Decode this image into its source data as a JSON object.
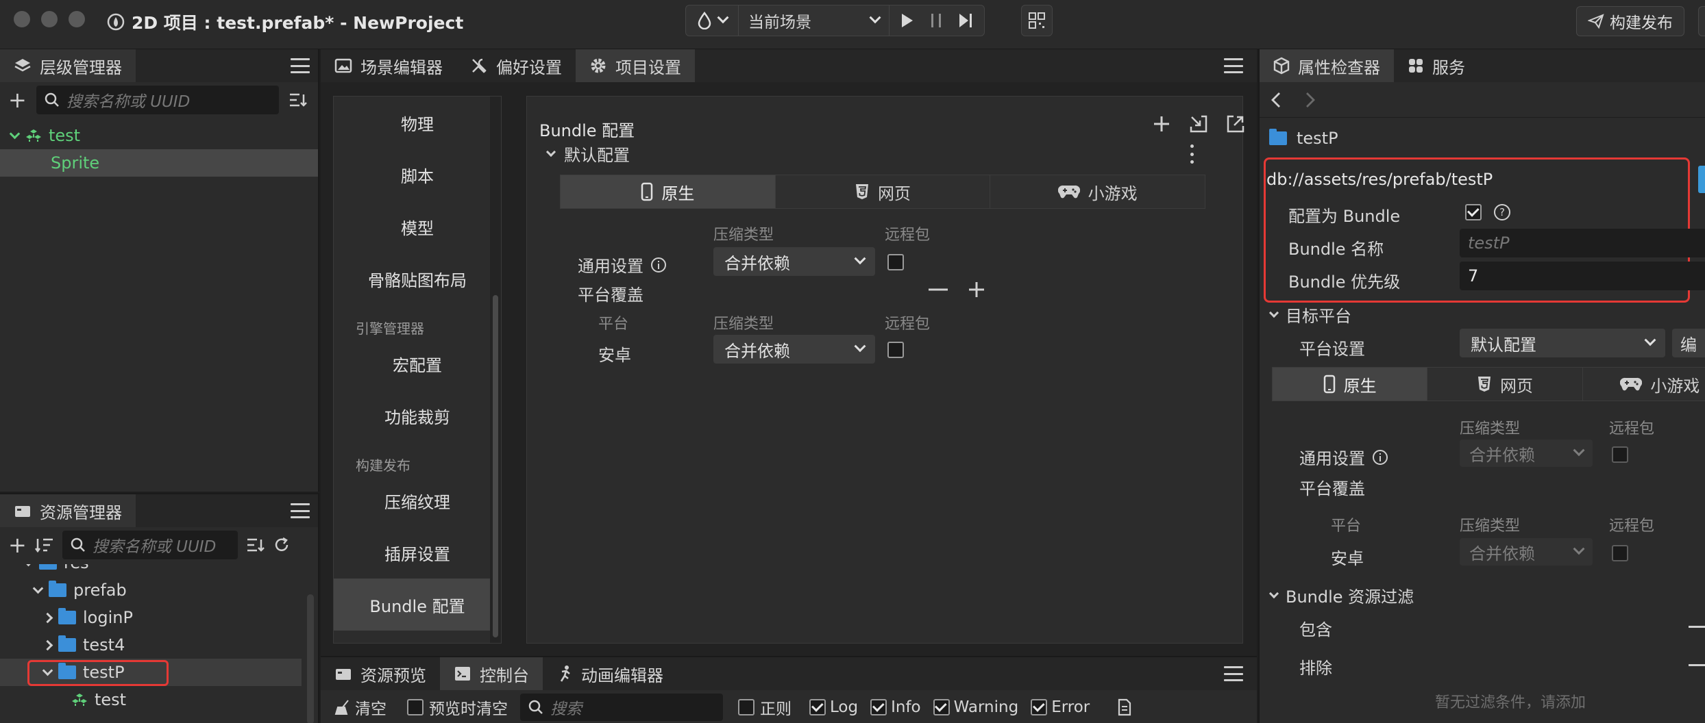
{
  "window": {
    "title": "2D 项目 : test.prefab* - NewProject",
    "scene_select": "当前场景",
    "build_button": "构建发布"
  },
  "hierarchy": {
    "tab": "层级管理器",
    "search_placeholder": "搜索名称或 UUID",
    "root": "test",
    "child": "Sprite"
  },
  "assets": {
    "tab": "资源管理器",
    "search_placeholder": "搜索名称或 UUID",
    "items": {
      "res": "res",
      "prefab": "prefab",
      "loginP": "loginP",
      "test4": "test4",
      "testP": "testP",
      "test": "test"
    }
  },
  "center_tabs": {
    "scene_editor": "场景编辑器",
    "preferences": "偏好设置",
    "project_settings": "项目设置"
  },
  "settings_nav": {
    "items": [
      "物理",
      "脚本",
      "模型",
      "骨骼贴图布局"
    ],
    "group_engine": "引擎管理器",
    "engine_items": [
      "宏配置",
      "功能裁剪"
    ],
    "group_build": "构建发布",
    "build_items": [
      "压缩纹理",
      "插屏设置",
      "Bundle 配置"
    ]
  },
  "bundle_panel": {
    "title": "Bundle 配置",
    "default_config": "默认配置",
    "platform_tabs": [
      "原生",
      "网页",
      "小游戏"
    ],
    "col_compress": "压缩类型",
    "col_remote": "远程包",
    "general_settings": "通用设置",
    "general_value": "合并依赖",
    "platform_override": "平台覆盖",
    "col_platform": "平台",
    "android": "安卓",
    "android_value": "合并依赖"
  },
  "bottom": {
    "tabs": [
      "资源预览",
      "控制台",
      "动画编辑器"
    ],
    "clear": "清空",
    "clear_on_preview": "预览时清空",
    "search_placeholder": "搜索",
    "regex": "正则",
    "filters": [
      "Log",
      "Info",
      "Warning",
      "Error"
    ]
  },
  "inspector": {
    "tab": "属性检查器",
    "service_tab": "服务",
    "asset_name": "testP",
    "path": "db://assets/res/prefab/testP",
    "config_as_bundle": "配置为 Bundle",
    "bundle_name_label": "Bundle 名称",
    "bundle_name_placeholder": "testP",
    "bundle_priority_label": "Bundle 优先级",
    "bundle_priority_value": "7",
    "target_platform": "目标平台",
    "platform_setting_label": "平台设置",
    "platform_setting_value": "默认配置",
    "platform_setting_extra": "编",
    "platform_tabs": [
      "原生",
      "网页",
      "小游戏"
    ],
    "col_compress": "压缩类型",
    "col_remote": "远程包",
    "general_settings": "通用设置",
    "general_value": "合并依赖",
    "platform_override": "平台覆盖",
    "col_platform": "平台",
    "android": "安卓",
    "android_value": "合并依赖",
    "bundle_filter": "Bundle 资源过滤",
    "include": "包含",
    "exclude": "排除",
    "no_filter": "暂无过滤条件，请添加"
  },
  "colors": {
    "accent_green": "#5fd07a",
    "highlight_red": "#e53935",
    "folder_blue": "#3b8fd9"
  }
}
